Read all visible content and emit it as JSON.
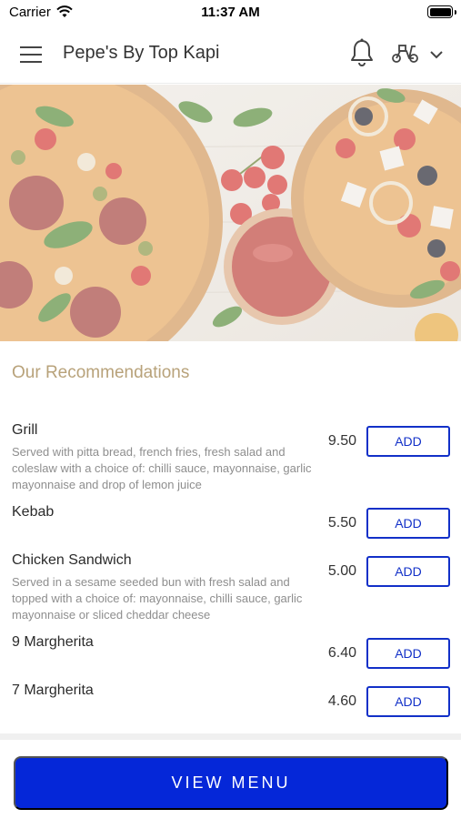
{
  "status_bar": {
    "carrier": "Carrier",
    "time": "11:37 AM"
  },
  "header": {
    "title": "Pepe's By Top Kapi"
  },
  "section": {
    "title": "Our Recommendations"
  },
  "add_label": "ADD",
  "items": [
    {
      "name": "Grill",
      "desc": "Served with pitta bread, french fries, fresh salad and coleslaw with a choice of: chilli sauce, mayonnaise, garlic mayonnaise and drop of lemon juice",
      "price": "9.50"
    },
    {
      "name": "Kebab",
      "desc": "",
      "price": "5.50"
    },
    {
      "name": "Chicken Sandwich",
      "desc": "Served in a sesame seeded bun with fresh salad and topped with a choice of: mayonnaise, chilli sauce, garlic mayonnaise or sliced cheddar cheese",
      "price": "5.00"
    },
    {
      "name": "9 Margherita",
      "desc": "",
      "price": "6.40"
    },
    {
      "name": "7 Margherita",
      "desc": "",
      "price": "4.60"
    }
  ],
  "footer": {
    "view_menu_label": "VIEW MENU"
  },
  "colors": {
    "accent": "#0527d8",
    "section_title": "#b8a27a"
  },
  "icons": [
    "hamburger-menu-icon",
    "bell-icon",
    "scooter-icon",
    "chevron-down-icon",
    "wifi-icon",
    "battery-icon"
  ]
}
